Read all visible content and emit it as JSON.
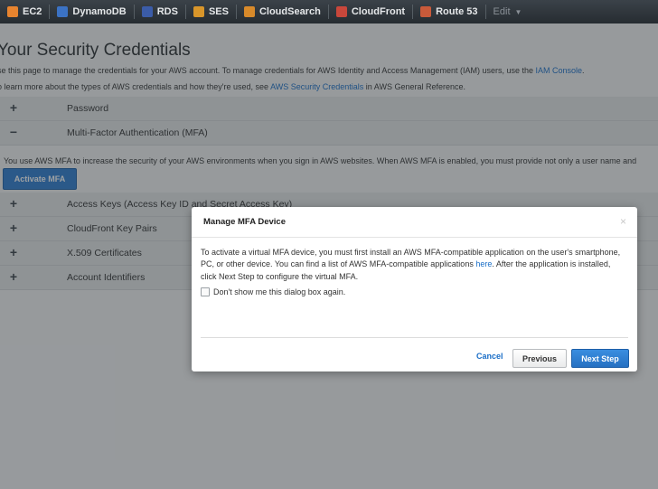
{
  "nav": {
    "items": [
      {
        "label": "EC2",
        "color": "#e8842f"
      },
      {
        "label": "DynamoDB",
        "color": "#3b72c4"
      },
      {
        "label": "RDS",
        "color": "#3b5ca8"
      },
      {
        "label": "SES",
        "color": "#d9962a"
      },
      {
        "label": "CloudSearch",
        "color": "#d88a2a"
      },
      {
        "label": "CloudFront",
        "color": "#c9473b"
      },
      {
        "label": "Route 53",
        "color": "#c95a3a"
      }
    ],
    "edit_label": "Edit"
  },
  "page": {
    "title": "Your Security Credentials",
    "intro1_text": "se this page to manage the credentials for your AWS account. To manage credentials for AWS Identity and Access Management (IAM) users, use the",
    "intro1_link": "IAM Console",
    "intro1_end": ".",
    "intro2_text": "o learn more about the types of AWS credentials and how they're used, see",
    "intro2_link": "AWS Security Credentials",
    "intro2_end": "in AWS General Reference."
  },
  "accordion": {
    "password": {
      "sign": "+",
      "label": "Password"
    },
    "mfa": {
      "sign": "−",
      "label": "Multi-Factor Authentication (MFA)"
    },
    "mfa_description": "You use AWS MFA to increase the security of your AWS environments when you sign in AWS websites. When AWS MFA is enabled, you must provide not only a user name and",
    "activate_label": "Activate MFA",
    "access_keys": {
      "sign": "+",
      "label": "Access Keys (Access Key ID and Secret Access Key)"
    },
    "cloudfront_keys": {
      "sign": "+",
      "label": "CloudFront Key Pairs"
    },
    "x509": {
      "sign": "+",
      "label": "X.509 Certificates"
    },
    "account_ids": {
      "sign": "+",
      "label": "Account Identifiers"
    }
  },
  "modal": {
    "title": "Manage MFA Device",
    "close": "×",
    "body_part1": "To activate a virtual MFA device, you must first install an AWS MFA-compatible application on the user's smartphone, PC, or other device. You can find a list of AWS MFA-compatible applications",
    "body_link": "here",
    "body_part2": ". After the application is installed, click Next Step to configure the virtual MFA.",
    "checkbox_label": "Don't show me this dialog box again.",
    "cancel_label": "Cancel",
    "previous_label": "Previous",
    "next_label": "Next Step"
  }
}
